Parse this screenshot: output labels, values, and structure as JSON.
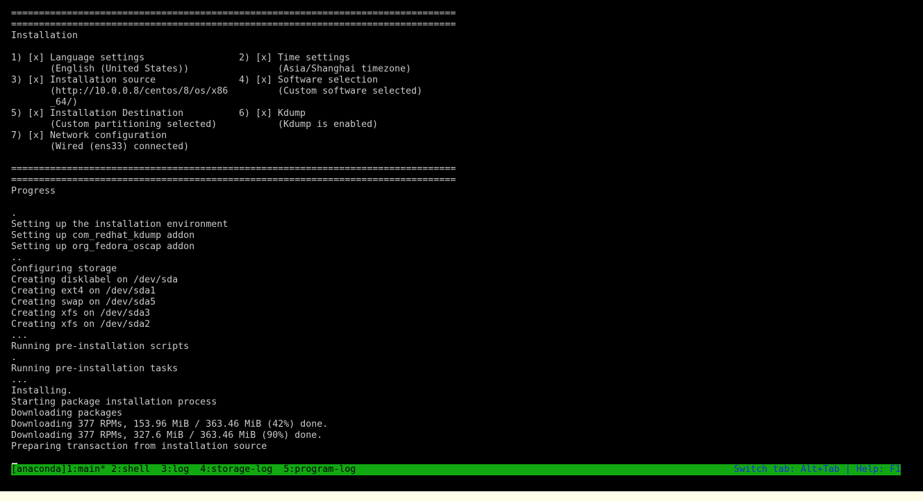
{
  "summary": {
    "separator_1": "================================================================================",
    "separator_2": "================================================================================",
    "title": "Installation",
    "items": [
      {
        "label": "1) [x] Language settings",
        "detail": "       (English (United States))"
      },
      {
        "label": "2) [x] Time settings",
        "detail": "       (Asia/Shanghai timezone)"
      },
      {
        "label": "3) [x] Installation source",
        "detail": "       (http://10.0.0.8/centos/8/os/x86",
        "detail_2": "       _64/)"
      },
      {
        "label": "4) [x] Software selection",
        "detail": "       (Custom software selected)"
      },
      {
        "label": "5) [x] Installation Destination",
        "detail": "       (Custom partitioning selected)"
      },
      {
        "label": "6) [x] Kdump",
        "detail": "       (Kdump is enabled)"
      },
      {
        "label": "7) [x] Network configuration",
        "detail": "       (Wired (ens33) connected)"
      }
    ]
  },
  "progress": {
    "separator_1": "================================================================================",
    "separator_2": "================================================================================",
    "title": "Progress",
    "lines": [
      "",
      ".",
      "Setting up the installation environment",
      "Setting up com_redhat_kdump addon",
      "Setting up org_fedora_oscap addon",
      "..",
      "Configuring storage",
      "Creating disklabel on /dev/sda",
      "Creating ext4 on /dev/sda1",
      "Creating swap on /dev/sda5",
      "Creating xfs on /dev/sda3",
      "Creating xfs on /dev/sda2",
      "...",
      "Running pre-installation scripts",
      ".",
      "Running pre-installation tasks",
      "...",
      "Installing.",
      "Starting package installation process",
      "Downloading packages",
      "Downloading 377 RPMs, 153.96 MiB / 363.46 MiB (42%) done.",
      "Downloading 377 RPMs, 327.6 MiB / 363.46 MiB (90%) done.",
      "Preparing transaction from installation source"
    ]
  },
  "status_bar": {
    "session": "[anaconda]",
    "tabs": [
      "1:main*",
      "2:shell ",
      "3:log ",
      "4:storage-log ",
      "5:program-log"
    ],
    "help": "Switch tab: Alt+Tab | Help: F1"
  },
  "colors": {
    "background": "#000000",
    "text": "#c9c9c9",
    "status_bar": "#12a812",
    "status_help_text": "#1a2bd6"
  }
}
